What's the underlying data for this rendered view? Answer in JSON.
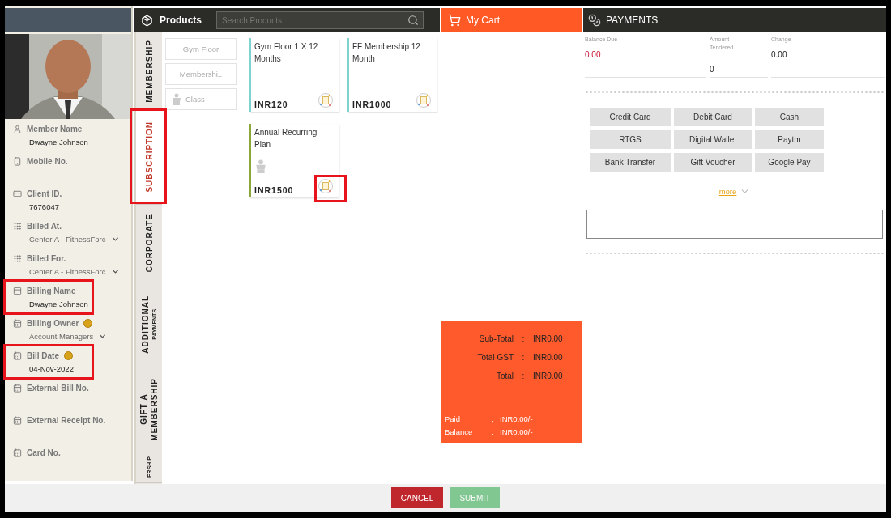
{
  "sidebar": {
    "fields": [
      {
        "label": "Member Name",
        "value": "Dwayne Johnson",
        "kind": "text",
        "info": false,
        "highlighted": false
      },
      {
        "label": "Mobile No.",
        "info": false,
        "highlighted": false
      },
      {
        "label": "Client ID.",
        "value": "7676047",
        "kind": "text",
        "info": false,
        "highlighted": false
      },
      {
        "label": "Billed At.",
        "value": "Center A - FitnessForc",
        "kind": "select",
        "info": false,
        "highlighted": false
      },
      {
        "label": "Billed For.",
        "value": "Center A - FitnessForc",
        "kind": "select",
        "info": false,
        "highlighted": false
      },
      {
        "label": "Billing Name",
        "value": "Dwayne  Johnson",
        "kind": "text",
        "info": false,
        "highlighted": true
      },
      {
        "label": "Billing Owner",
        "value": "Account Managers",
        "kind": "select",
        "info": true,
        "highlighted": false
      },
      {
        "label": "Bill Date",
        "value": "04-Nov-2022",
        "kind": "text",
        "info": true,
        "highlighted": true
      },
      {
        "label": "External Bill No.",
        "info": false,
        "highlighted": false
      },
      {
        "label": "External Receipt No.",
        "info": false,
        "highlighted": false
      },
      {
        "label": "Card No.",
        "info": false,
        "highlighted": false
      }
    ]
  },
  "products": {
    "title": "Products",
    "search": {
      "placeholder": "Search Products"
    },
    "tabs": [
      {
        "lines": [
          "MEMBERSHIP"
        ],
        "selected": false,
        "highlighted": false
      },
      {
        "lines": [
          "SUBSCRIPTION"
        ],
        "selected": true,
        "highlighted": true
      },
      {
        "lines": [
          "CORPORATE"
        ],
        "selected": false,
        "highlighted": false
      },
      {
        "lines": [
          "ADDITIONAL",
          "PAYMENTS"
        ],
        "selected": false,
        "highlighted": false
      },
      {
        "lines": [
          "GIFT A",
          "MEMBERSHIP"
        ],
        "selected": false,
        "highlighted": false
      },
      {
        "lines": [
          "ERSHIP"
        ],
        "selected": false,
        "highlighted": false
      }
    ],
    "categories": [
      {
        "label": "Gym Floor",
        "has_icon": false
      },
      {
        "label": "Membershi..",
        "has_icon": false
      },
      {
        "label": "Class",
        "has_icon": true
      }
    ],
    "cards": [
      {
        "title": "Gym Floor 1 X 12 Months",
        "price": "INR120",
        "color": "#7fd3cf",
        "has_figure": false,
        "highlighted": false
      },
      {
        "title": "FF Membership 12 Month",
        "price": "INR1000",
        "color": "#7fd3cf",
        "has_figure": false,
        "highlighted": false
      },
      {
        "title": "Annual Recurring Plan",
        "price": "INR1500",
        "color": "#8aa83a",
        "has_figure": true,
        "highlighted": true
      }
    ]
  },
  "cart": {
    "title": "My Cart",
    "totals": [
      {
        "label": "Sub-Total",
        "sep": ":",
        "value": "INR0.00"
      },
      {
        "label": "Total GST",
        "sep": ":",
        "value": "INR0.00"
      },
      {
        "label": "Total",
        "sep": ":",
        "value": "INR0.00"
      }
    ],
    "balances": [
      {
        "label": "Paid",
        "sep": ";",
        "value": "INR0.00/-"
      },
      {
        "label": "Balance",
        "sep": ":",
        "value": "INR0.00/-"
      }
    ]
  },
  "payments": {
    "title": "PAYMENTS",
    "summary": [
      {
        "label": "Balance Due",
        "value": "0.00",
        "kind": "due"
      },
      {
        "label": "Amount Tendered",
        "value": "0",
        "kind": "input"
      },
      {
        "label": "Change",
        "value": "0.00",
        "kind": "plain"
      }
    ],
    "methods": [
      "Credit Card",
      "Debit Card",
      "Cash",
      "RTGS",
      "Digital Wallet",
      "Paytm",
      "Bank Transfer",
      "Gift Voucher",
      "Google Pay"
    ],
    "more": "more"
  },
  "footer": {
    "buttons": [
      {
        "label": "CANCEL",
        "kind": "cancel",
        "disabled": false
      },
      {
        "label": "SUBMIT",
        "kind": "submit",
        "disabled": true
      }
    ]
  }
}
